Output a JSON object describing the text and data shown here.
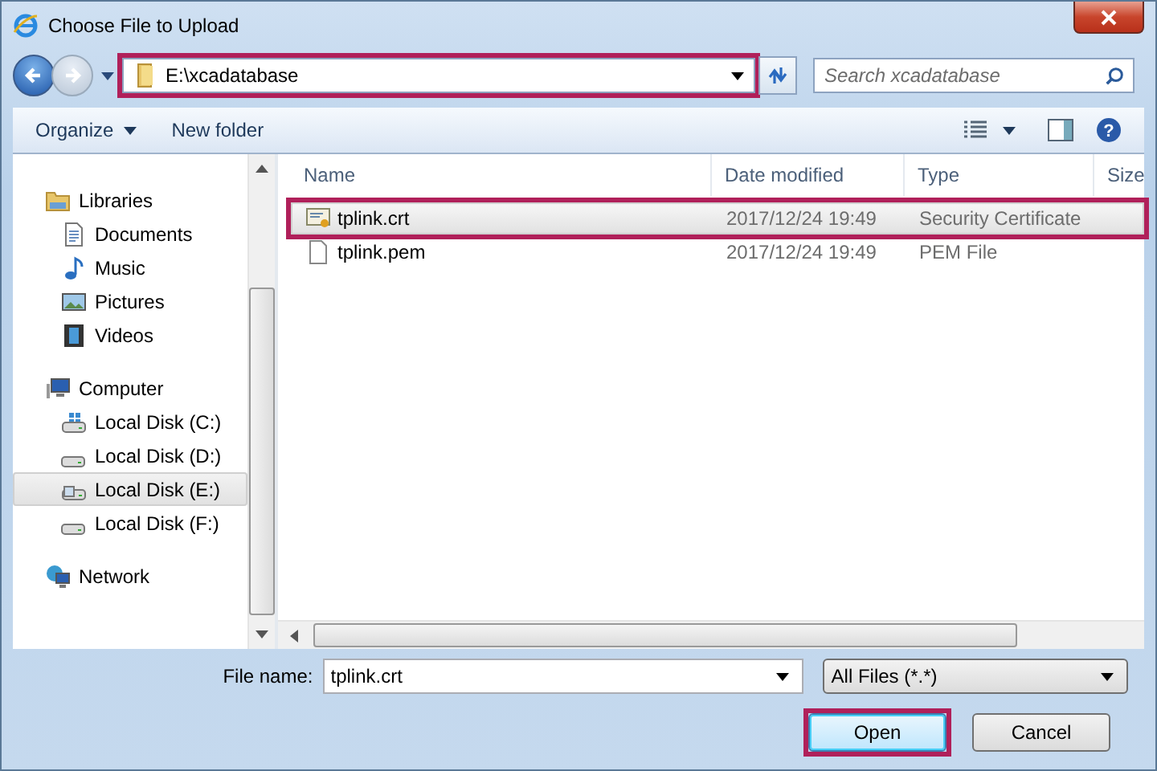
{
  "window": {
    "title": "Choose File to Upload"
  },
  "address": {
    "path": "E:\\xcadatabase",
    "highlighted": true
  },
  "search": {
    "placeholder": "Search xcadatabase"
  },
  "help": {
    "glyph": "?"
  },
  "toolbar": [
    {
      "label": "Organize",
      "kind": "menu"
    },
    {
      "label": "New folder",
      "kind": "button"
    }
  ],
  "nav": [
    {
      "label": "Libraries",
      "kind": "library",
      "selected": false,
      "children": [
        {
          "label": "Documents",
          "kind": "documents",
          "selected": false
        },
        {
          "label": "Music",
          "kind": "music",
          "selected": false
        },
        {
          "label": "Pictures",
          "kind": "pictures",
          "selected": false
        },
        {
          "label": "Videos",
          "kind": "videos",
          "selected": false
        }
      ]
    },
    {
      "label": "Computer",
      "kind": "computer",
      "selected": false,
      "children": [
        {
          "label": "Local Disk (C:)",
          "kind": "system-drive",
          "selected": false
        },
        {
          "label": "Local Disk (D:)",
          "kind": "drive",
          "selected": false
        },
        {
          "label": "Local Disk (E:)",
          "kind": "image-drive",
          "selected": true
        },
        {
          "label": "Local Disk (F:)",
          "kind": "drive",
          "selected": false
        }
      ]
    },
    {
      "label": "Network",
      "kind": "network",
      "selected": false
    }
  ],
  "columns": [
    "Name",
    "Date modified",
    "Type",
    "Size"
  ],
  "files": [
    {
      "name": "tplink.crt",
      "kind": "certificate",
      "date": "2017/12/24 19:49",
      "type": "Security Certificate",
      "selected": true,
      "highlighted": true
    },
    {
      "name": "tplink.pem",
      "kind": "file",
      "date": "2017/12/24 19:49",
      "type": "PEM File",
      "selected": false,
      "highlighted": false
    }
  ],
  "file_name": {
    "label": "File name:",
    "value": "tplink.crt"
  },
  "file_type": {
    "value": "All Files (*.*)"
  },
  "buttons": [
    {
      "label": "Open",
      "default": true,
      "highlighted": true
    },
    {
      "label": "Cancel",
      "default": false,
      "highlighted": false
    }
  ]
}
